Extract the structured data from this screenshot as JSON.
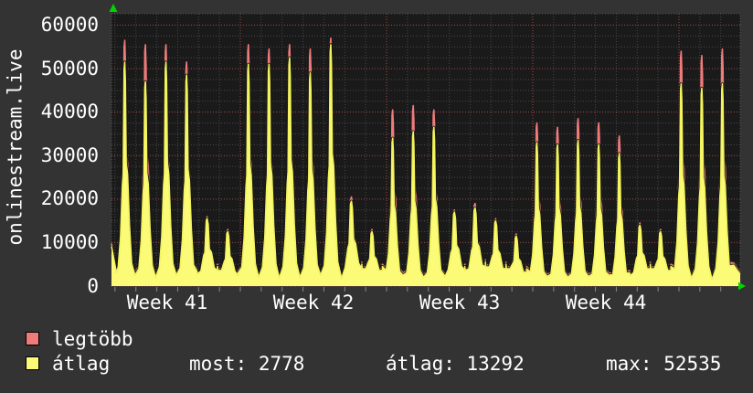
{
  "watermark": "onlinestream.live",
  "colors": {
    "bg_outer": "#333333",
    "bg_plot": "#1a1a1a",
    "grid_minor": "#484848",
    "grid_major": "#a84848",
    "plot_border": "#555555",
    "tick_mark": "#8a8a8a",
    "series_max": "#ef7b7b",
    "series_avg_fill": "#fbfb78",
    "series_avg_stroke": "#f2f25c",
    "series_outline": "#151515",
    "arrow": "#00d400",
    "text": "#ffffff"
  },
  "y_axis": {
    "tick_labels": [
      "60000",
      "50000",
      "40000",
      "30000",
      "20000",
      "10000",
      "0"
    ]
  },
  "x_axis": {
    "week_labels": [
      "Week 41",
      "Week 42",
      "Week 43",
      "Week 44"
    ]
  },
  "legend": {
    "items": [
      {
        "label": "legtöbb",
        "color": "#ef7b7b"
      },
      {
        "label": "átlag",
        "color": "#fbfb78"
      }
    ]
  },
  "stats": [
    {
      "label": "most",
      "value": "2778",
      "text": "most: 2778"
    },
    {
      "label": "átlag",
      "value": "13292",
      "text": "átlag: 13292"
    },
    {
      "label": "max",
      "value": "52535",
      "text": "max: 52535"
    }
  ],
  "chart_data": {
    "type": "area",
    "title": "onlinestream.live",
    "xlabel": "",
    "ylabel": "",
    "x_axis": {
      "tick_labels": [
        "Week 41",
        "Week 42",
        "Week 43",
        "Week 44"
      ],
      "unit": "day",
      "days_shown": 30
    },
    "y_axis": {
      "tick_values": [
        0,
        10000,
        20000,
        30000,
        40000,
        50000,
        60000
      ],
      "ylim": [
        0,
        62000
      ],
      "minor_step": 2500
    },
    "grid": true,
    "legend_position": "bottom-left",
    "series": [
      {
        "name": "legtöbb",
        "daily_peak_values": [
          56500,
          55500,
          55500,
          51500,
          16000,
          13000,
          55500,
          54500,
          55500,
          54500,
          57000,
          20500,
          13000,
          40500,
          41500,
          40500,
          17500,
          19000,
          15500,
          12000,
          37500,
          36500,
          38500,
          37500,
          34500,
          14500,
          13000,
          54000,
          53000,
          54500
        ]
      },
      {
        "name": "átlag",
        "daily_peak_values": [
          51500,
          47000,
          51500,
          48500,
          15500,
          12500,
          51000,
          51000,
          52500,
          49000,
          55500,
          19500,
          12500,
          34000,
          35500,
          36500,
          17000,
          18000,
          15000,
          11500,
          33000,
          32500,
          33500,
          32500,
          30500,
          14000,
          12500,
          46500,
          45500,
          46500
        ]
      }
    ],
    "valley_values": [
      3000,
      2500,
      2000,
      2500,
      3500,
      4500,
      3000,
      2000,
      1800,
      2000,
      2500,
      2200,
      5000,
      4500,
      2500,
      2000,
      2500,
      4500,
      5500,
      5000,
      4000,
      2200,
      2000,
      2200,
      2500,
      3000,
      5000,
      4500,
      1800,
      1500,
      2500
    ],
    "start_value": 9500,
    "end_value": 2778,
    "summary": {
      "most": 2778,
      "átlag": 13292,
      "max": 52535
    }
  }
}
